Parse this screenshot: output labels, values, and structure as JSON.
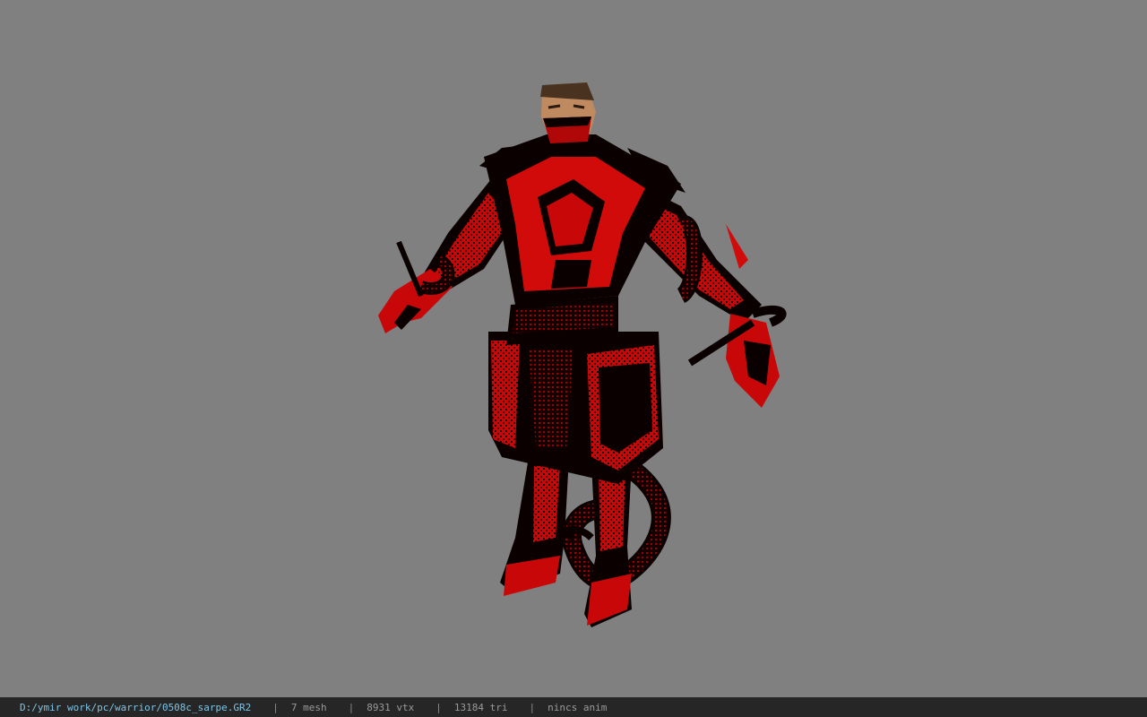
{
  "viewer": {
    "background_color": "#808080"
  },
  "model": {
    "name": "warrior-armor-model",
    "armor_color": "#d10a0a",
    "shadow_color": "#0a0000",
    "skin_color": "#c08a60"
  },
  "status_bar": {
    "file_path": "D:/ymir work/pc/warrior/0508c_sarpe.GR2",
    "separator": "|",
    "mesh_count": "7 mesh",
    "vertex_count": "8931 vtx",
    "triangle_count": "13184 tri",
    "animation": "nincs anim"
  }
}
